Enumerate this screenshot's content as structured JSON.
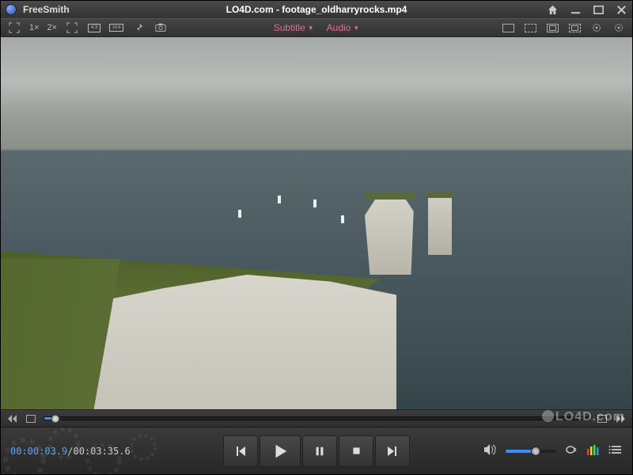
{
  "titlebar": {
    "app_name": "FreeSmith",
    "file_name": "LO4D.com - footage_oldharryrocks.mp4"
  },
  "toolbar": {
    "zoom1": "1×",
    "zoom2": "2×",
    "subtitle_label": "Subtitle",
    "audio_label": "Audio",
    "dropdown_value": "none"
  },
  "playback": {
    "current_time": "00:00:03.9",
    "separator": "/",
    "total_time": "00:03:35.6",
    "progress_percent": 2,
    "volume_percent": 60
  },
  "watermark": "LO4D.com"
}
